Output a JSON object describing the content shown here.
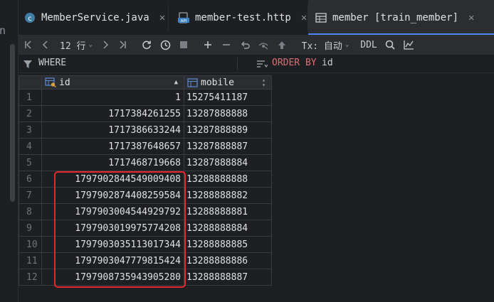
{
  "tabs": [
    {
      "label": "MemberService.java",
      "icon": "java-class-icon"
    },
    {
      "label": "member-test.http",
      "icon": "http-api-icon"
    },
    {
      "label": "member [train_member]",
      "icon": "table-icon"
    }
  ],
  "gutter": {
    "letter": "n"
  },
  "toolbar": {
    "rows_count": "12 行",
    "tx_label": "Tx: 自动",
    "ddl_label": "DDL"
  },
  "filter": {
    "where_label": "WHERE",
    "order_by_label": "ORDER BY",
    "order_by_value": "id"
  },
  "table": {
    "columns": [
      {
        "name": "id",
        "sort": "ascending"
      },
      {
        "name": "mobile"
      }
    ],
    "rows": [
      {
        "n": "1",
        "id": "1",
        "mobile": "15275411187"
      },
      {
        "n": "2",
        "id": "1717384261255",
        "mobile": "13287888888"
      },
      {
        "n": "3",
        "id": "1717386633244",
        "mobile": "13287888889"
      },
      {
        "n": "4",
        "id": "1717387648657",
        "mobile": "13287888887"
      },
      {
        "n": "5",
        "id": "1717468719668",
        "mobile": "13287888884"
      },
      {
        "n": "6",
        "id": "1797902844549009408",
        "mobile": "13288888888"
      },
      {
        "n": "7",
        "id": "1797902874408259584",
        "mobile": "13288888882"
      },
      {
        "n": "8",
        "id": "1797903004544929792",
        "mobile": "13288888881"
      },
      {
        "n": "9",
        "id": "1797903019975774208",
        "mobile": "13288888884"
      },
      {
        "n": "10",
        "id": "1797903035113017344",
        "mobile": "13288888885"
      },
      {
        "n": "11",
        "id": "1797903047779815424",
        "mobile": "13288888886"
      },
      {
        "n": "12",
        "id": "1797908735943905280",
        "mobile": "13288888887"
      }
    ]
  },
  "colors": {
    "accent": "#4a88f7",
    "highlight": "#e5262b",
    "order_by": "#e06c75"
  }
}
